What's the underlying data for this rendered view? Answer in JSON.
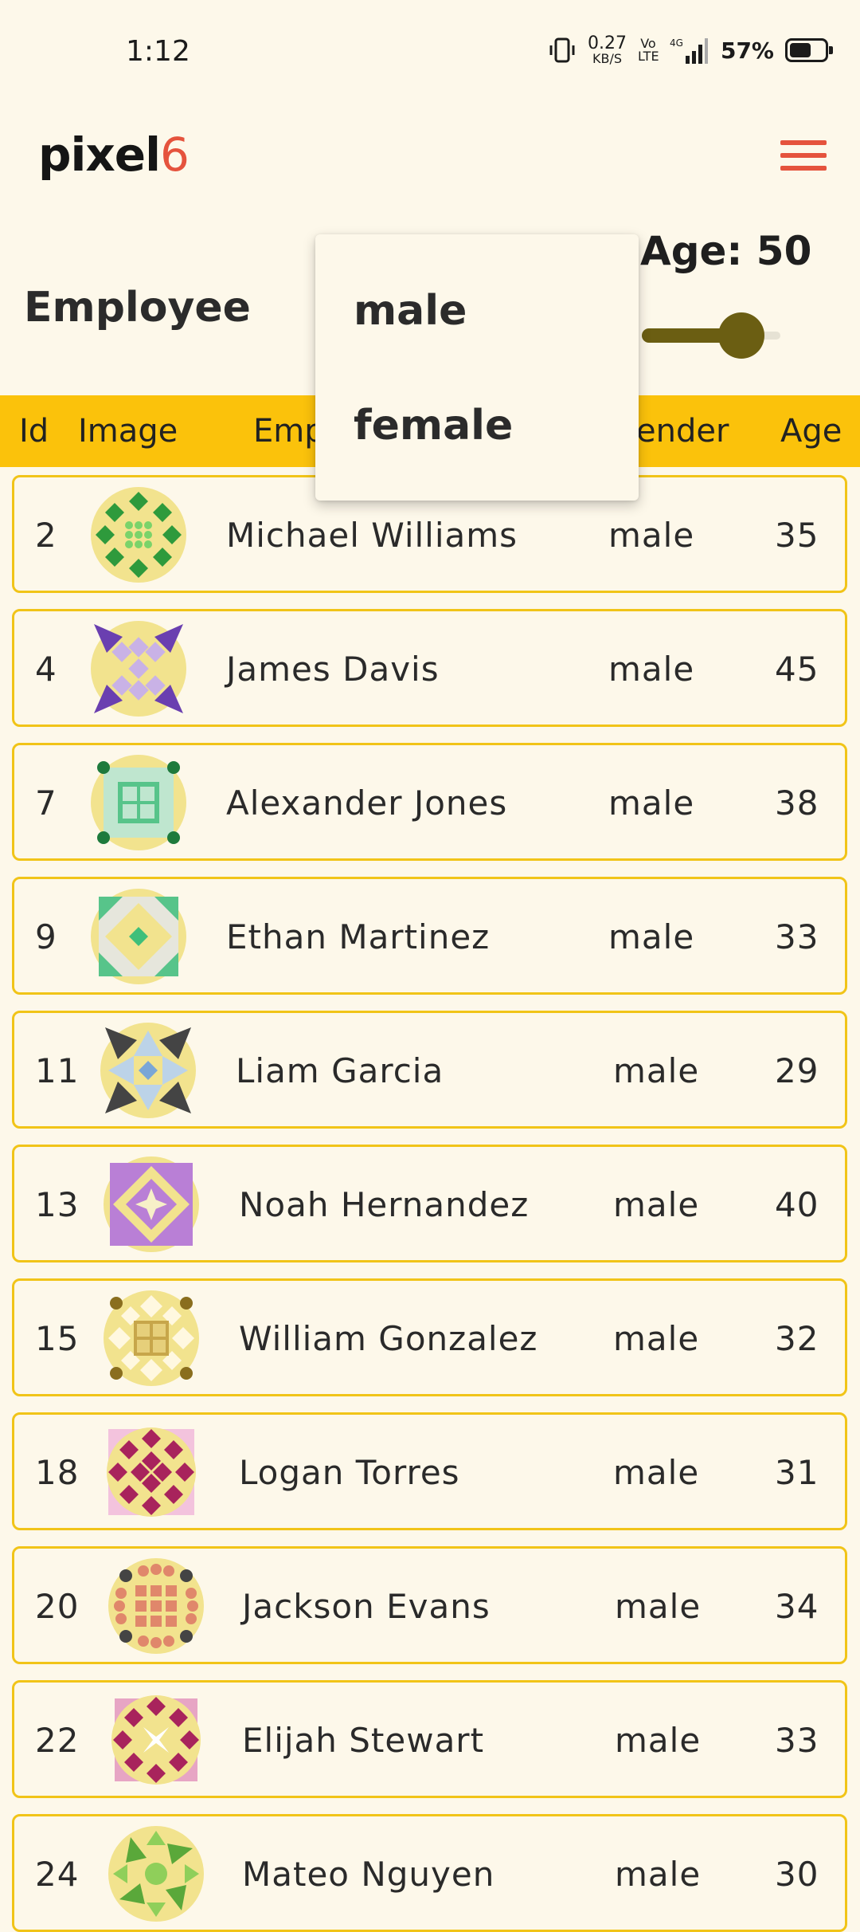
{
  "status": {
    "time": "1:12",
    "net_speed": "0.27",
    "net_unit": "KB/S",
    "volte": "Vo LTE",
    "network": "4G",
    "battery": "57%"
  },
  "app": {
    "logo_text": "pixel",
    "logo_accent": "6",
    "accent_color": "#e5533d"
  },
  "filters": {
    "title": "Employee",
    "age_label": "Age: 50",
    "age_value": 50
  },
  "columns": [
    "Id",
    "Image",
    "Employee",
    "Gender",
    "Age"
  ],
  "dropdown": {
    "options": [
      "male",
      "female"
    ]
  },
  "rows": [
    {
      "id": "2",
      "name": "Michael  Williams",
      "gender": "male",
      "age": "35",
      "image": "green-quilt-icon"
    },
    {
      "id": "4",
      "name": "James  Davis",
      "gender": "male",
      "age": "45",
      "image": "purple-quilt-icon"
    },
    {
      "id": "7",
      "name": "Alexander  Jones",
      "gender": "male",
      "age": "38",
      "image": "mint-quilt-icon"
    },
    {
      "id": "9",
      "name": "Ethan  Martinez",
      "gender": "male",
      "age": "33",
      "image": "teal-diamond-quilt-icon"
    },
    {
      "id": "11",
      "name": "Liam  Garcia",
      "gender": "male",
      "age": "29",
      "image": "gray-pinwheel-quilt-icon"
    },
    {
      "id": "13",
      "name": "Noah  Hernandez",
      "gender": "male",
      "age": "40",
      "image": "violet-quilt-icon"
    },
    {
      "id": "15",
      "name": "William  Gonzalez",
      "gender": "male",
      "age": "32",
      "image": "olive-quilt-icon"
    },
    {
      "id": "18",
      "name": "Logan  Torres",
      "gender": "male",
      "age": "31",
      "image": "magenta-quilt-icon"
    },
    {
      "id": "20",
      "name": "Jackson  Evans",
      "gender": "male",
      "age": "34",
      "image": "salmon-dots-quilt-icon"
    },
    {
      "id": "22",
      "name": "Elijah  Stewart",
      "gender": "male",
      "age": "33",
      "image": "maroon-quilt-icon"
    },
    {
      "id": "24",
      "name": "Mateo  Nguyen",
      "gender": "male",
      "age": "30",
      "image": "leaf-quilt-icon"
    }
  ]
}
